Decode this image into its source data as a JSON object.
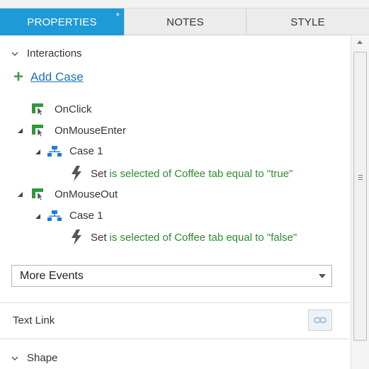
{
  "tabs": {
    "properties": "PROPERTIES",
    "properties_marker": "*",
    "notes": "NOTES",
    "style": "STYLE"
  },
  "interactions": {
    "header": "Interactions",
    "add_case": "Add Case",
    "events": [
      {
        "name": "OnClick"
      },
      {
        "name": "OnMouseEnter",
        "case": "Case 1",
        "action": "Set",
        "detail": "is selected of Coffee tab equal to \"true\""
      },
      {
        "name": "OnMouseOut",
        "case": "Case 1",
        "action": "Set",
        "detail": "is selected of Coffee tab equal to \"false\""
      }
    ],
    "more_events": "More Events"
  },
  "text_link": {
    "label": "Text Link"
  },
  "shape": {
    "header": "Shape"
  },
  "colors": {
    "accent": "#1e9ad6",
    "link": "#1a73b8",
    "action_detail": "#2e8b2e",
    "plus": "#43a047"
  },
  "icons": {
    "event": "event-cursor-icon",
    "case": "case-flow-icon",
    "action": "lightning-bolt-icon",
    "link": "link-icon"
  }
}
